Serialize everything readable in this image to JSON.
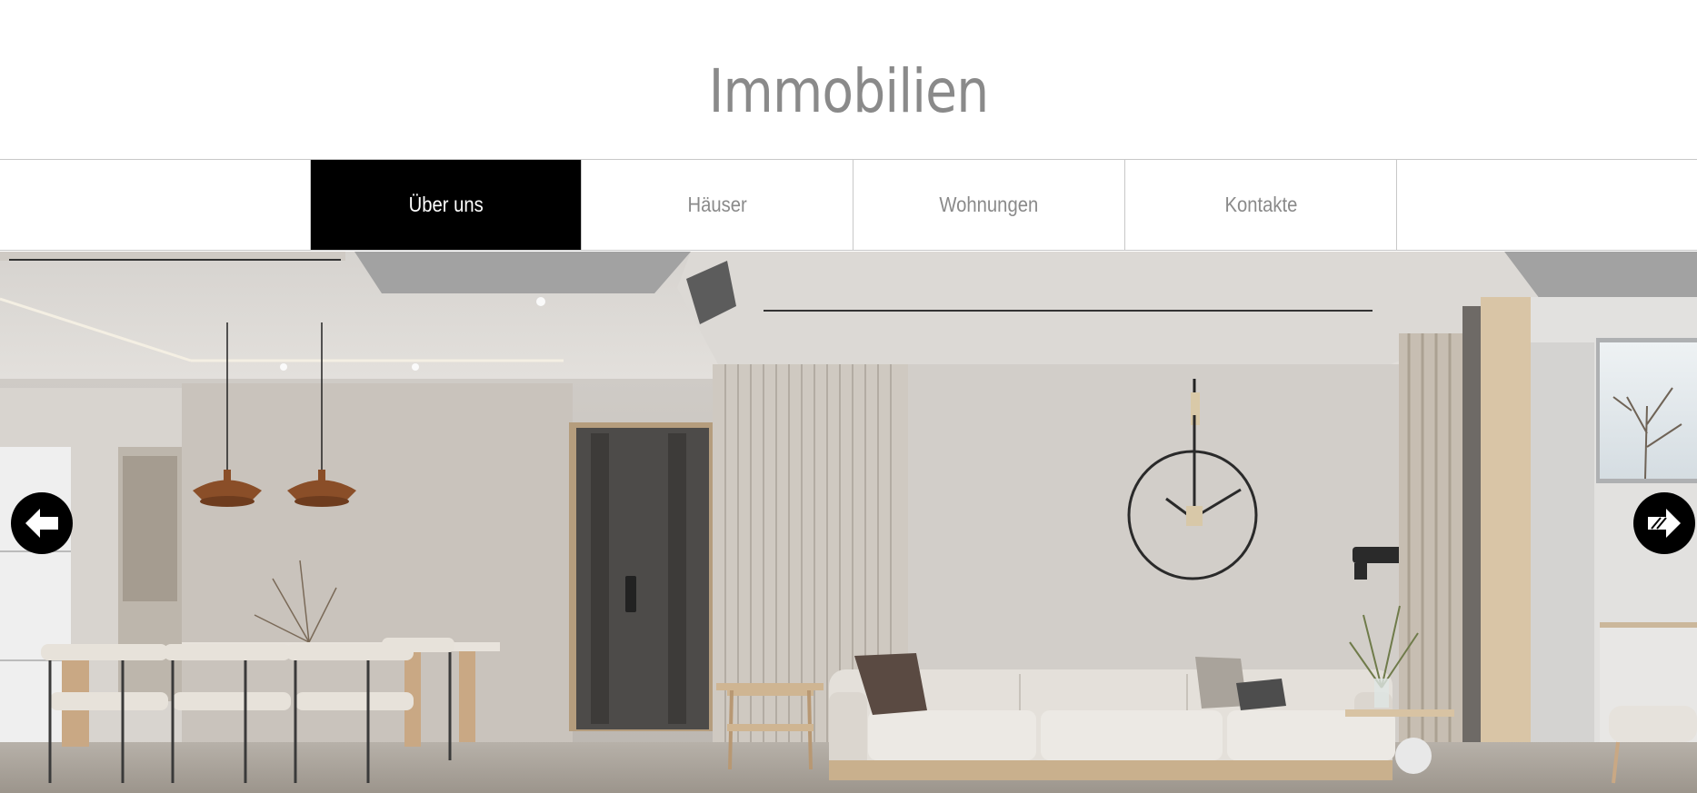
{
  "site": {
    "title": "Immobilien"
  },
  "nav": {
    "items": [
      {
        "label": "Über uns",
        "active": true
      },
      {
        "label": "Häuser",
        "active": false
      },
      {
        "label": "Wohnungen",
        "active": false
      },
      {
        "label": "Kontakte",
        "active": false
      }
    ]
  },
  "slider": {
    "image": "living-room-interior",
    "prev_icon": "arrow-left-icon",
    "next_icon": "arrow-right-icon"
  }
}
